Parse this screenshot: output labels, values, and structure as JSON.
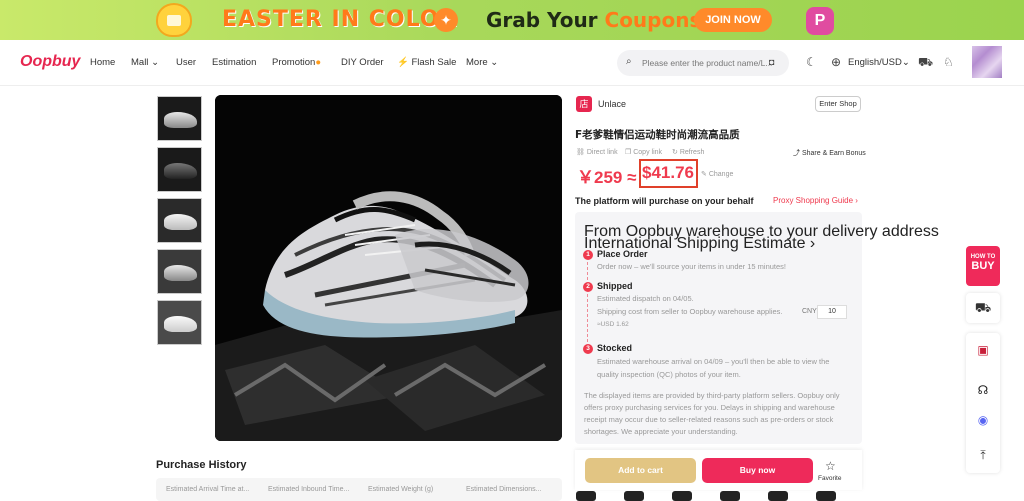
{
  "banner": {
    "title1": "EASTER IN COLOR",
    "title2_prefix": "Grab Your",
    "title2_highlight": "Coupons",
    "join_label": "JOIN NOW",
    "badge": "P"
  },
  "nav": {
    "logo": "Oopbuy",
    "items": [
      "Home",
      "Mall",
      "User",
      "Estimation",
      "Promotion",
      "DIY Order",
      "Flash Sale",
      "More"
    ],
    "search_placeholder": "Please enter the product name/L...",
    "language": "English/USD"
  },
  "purchase_history": {
    "title": "Purchase History",
    "columns": [
      "Estimated Arrival Time at...",
      "Estimated Inbound Time...",
      "Estimated Weight (g)",
      "Estimated Dimensions..."
    ]
  },
  "shop": {
    "icon": "店",
    "name": "Unlace",
    "enter_label": "Enter Shop"
  },
  "product": {
    "title": "F老爹鞋情侣运动鞋时尚潮流高品质",
    "direct_link": "Direct link",
    "copy_link": "Copy link",
    "refresh": "Refresh",
    "share": "Share & Earn Bonus",
    "price_cny": "￥259 ≈",
    "price_usd": "$41.76",
    "change": "Change"
  },
  "behalf": {
    "title": "The platform will purchase on your behalf",
    "guide": "Proxy Shopping Guide"
  },
  "steps_card": {
    "from": "From Oopbuy warehouse to your delivery address",
    "intl_link": "International Shipping Estimate",
    "steps": [
      {
        "num": "1",
        "title": "Place Order",
        "sub": "Order now – we'll source your items in under 15 minutes!"
      },
      {
        "num": "2",
        "title": "Shipped",
        "sub1": "Estimated dispatch on 04/05.",
        "sub2": "Shipping cost from seller to Oopbuy warehouse applies.",
        "sub3": "≈USD 1.62"
      },
      {
        "num": "3",
        "title": "Stocked",
        "sub1": "Estimated warehouse arrival on 04/09 – you'll then be able to view the",
        "sub2": "quality inspection (QC) photos of your item."
      }
    ],
    "cny_label": "CNY",
    "cny_value": "10",
    "disclaimer": "The displayed items are provided by third-party platform sellers. Oopbuy only offers proxy purchasing services for you. Delays in shipping and warehouse receipt may occur due to seller-related reasons such as pre-orders or stock shortages. We appreciate your understanding."
  },
  "actions": {
    "add_to_cart": "Add to cart",
    "buy_now": "Buy now",
    "favorite": "Favorite"
  },
  "sidebar": {
    "howto_a": "HOW TO",
    "howto_b": "BUY"
  }
}
